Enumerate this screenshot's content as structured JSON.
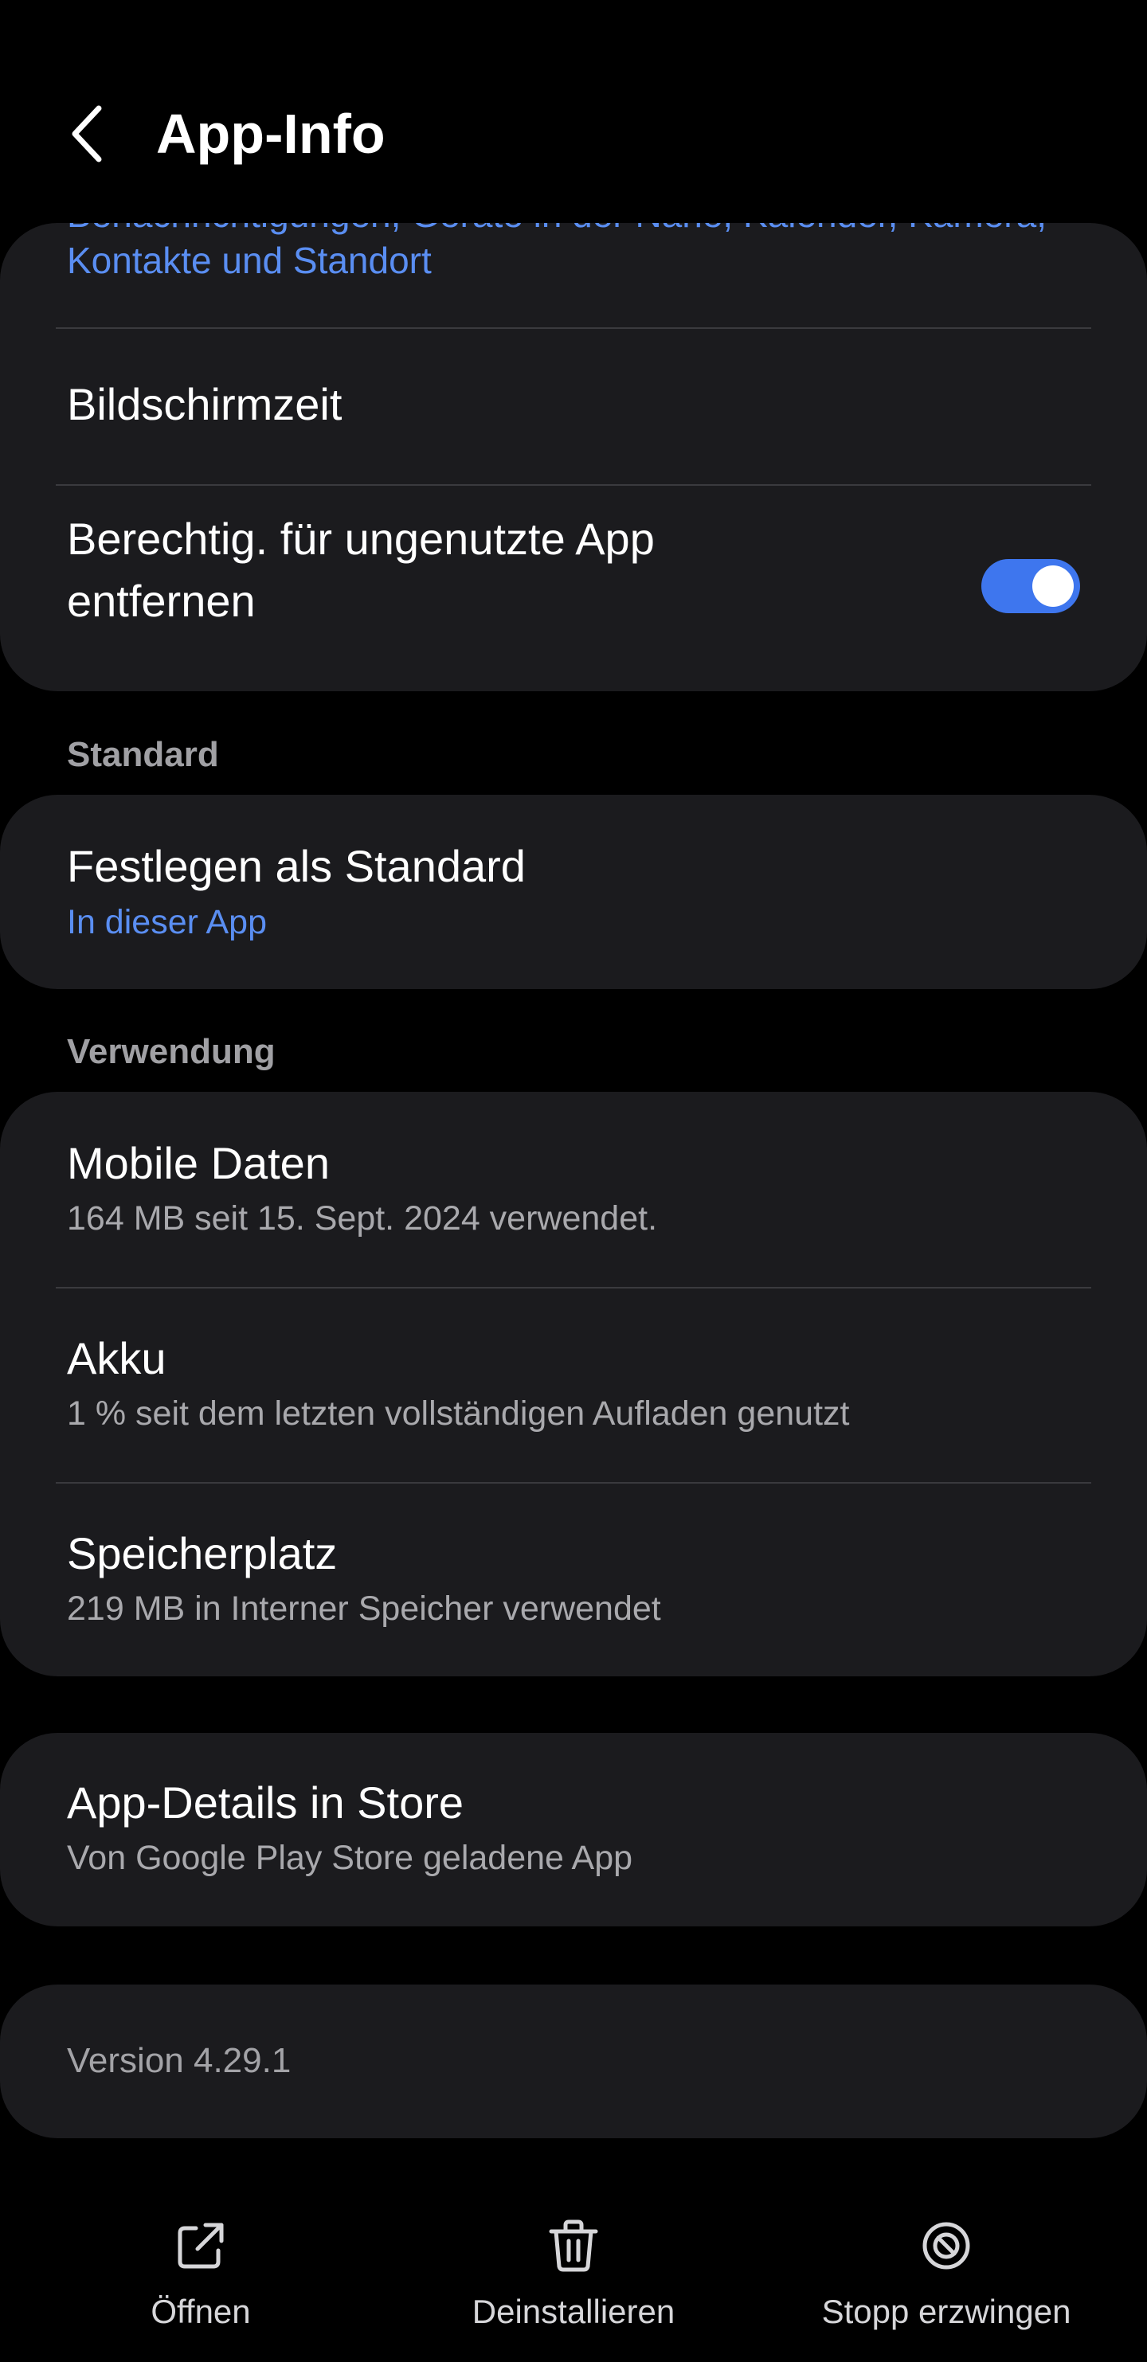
{
  "header": {
    "back_icon": "chevron-left-icon",
    "title": "App-Info"
  },
  "permissions_card": {
    "partial_line_1": "Benachrichtigungen, Geräte in der Nähe, Kalender, Kamera,",
    "partial_line_2": "Kontakte und Standort",
    "screen_time": "Bildschirmzeit",
    "remove_permissions_line_1": "Berechtig. für ungenutzte App",
    "remove_permissions_line_2": "entfernen",
    "remove_permissions_toggle": "on"
  },
  "standard_section": {
    "label": "Standard",
    "set_default_title": "Festlegen als Standard",
    "set_default_sub": "In dieser App"
  },
  "usage_section": {
    "label": "Verwendung",
    "mobile_data_title": "Mobile Daten",
    "mobile_data_sub": "164 MB seit 15. Sept. 2024 verwendet.",
    "battery_title": "Akku",
    "battery_sub": "1 % seit dem letzten vollständigen Aufladen genutzt",
    "storage_title": "Speicherplatz",
    "storage_sub": "219 MB in Interner Speicher verwendet"
  },
  "store_card": {
    "title": "App-Details in Store",
    "sub": "Von Google Play Store geladene App"
  },
  "version_card": {
    "version": "Version 4.29.1"
  },
  "bottom_actions": {
    "open_label": "Öffnen",
    "open_icon": "open-external-icon",
    "uninstall_label": "Deinstallieren",
    "uninstall_icon": "trash-icon",
    "force_stop_label": "Stopp erzwingen",
    "force_stop_icon": "block-icon"
  },
  "colors": {
    "background": "#000000",
    "card": "#1b1b1e",
    "accent": "#3e76ee",
    "link_blue": "#5a8ef2",
    "secondary_text": "#a9a9ad"
  }
}
